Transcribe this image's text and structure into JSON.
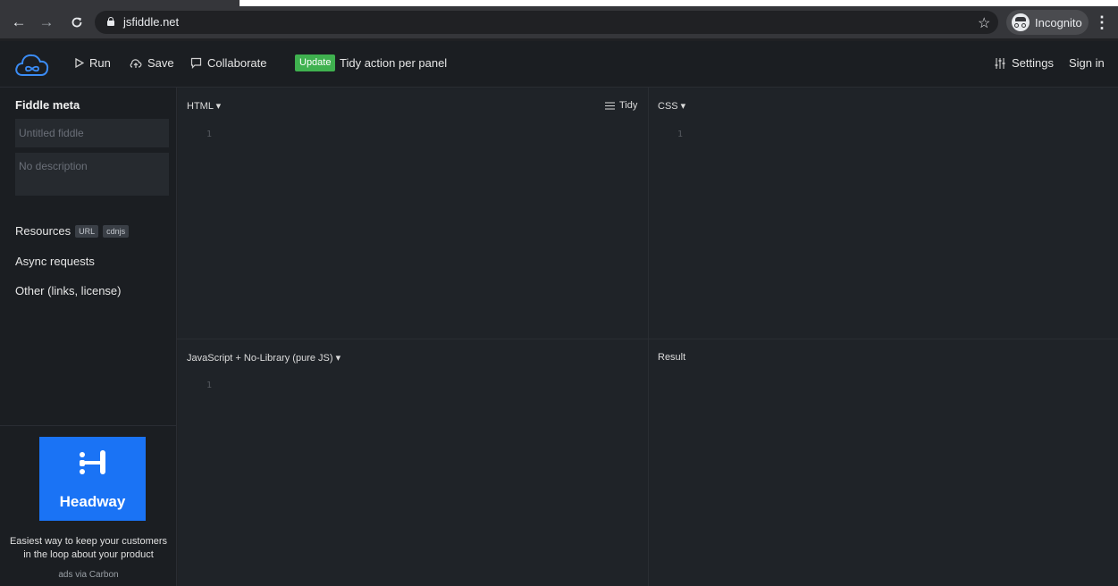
{
  "browser": {
    "url": "jsfiddle.net",
    "profile_label": "Incognito"
  },
  "header": {
    "run_label": "Run",
    "save_label": "Save",
    "collaborate_label": "Collaborate",
    "update_badge": "Update",
    "update_text": "Tidy action per panel",
    "settings_label": "Settings",
    "signin_label": "Sign in"
  },
  "sidebar": {
    "title": "Fiddle meta",
    "title_placeholder": "Untitled fiddle",
    "description_placeholder": "No description",
    "resources_label": "Resources",
    "resource_chips": [
      "URL",
      "cdnjs"
    ],
    "async_label": "Async requests",
    "other_label": "Other (links, license)"
  },
  "ad": {
    "brand": "Headway",
    "description_line1": "Easiest way to keep your customers",
    "description_line2": "in the loop about your product",
    "via": "ads via Carbon",
    "brand_color": "#1a73f5"
  },
  "panels": {
    "html": {
      "label": "HTML ▾",
      "line": "1",
      "tidy_label": "Tidy"
    },
    "css": {
      "label": "CSS ▾",
      "line": "1"
    },
    "js": {
      "label": "JavaScript + No-Library (pure JS) ▾",
      "line": "1"
    },
    "result": {
      "label": "Result"
    }
  },
  "colors": {
    "background": "#1f2328",
    "update_green": "#3fb14f"
  }
}
